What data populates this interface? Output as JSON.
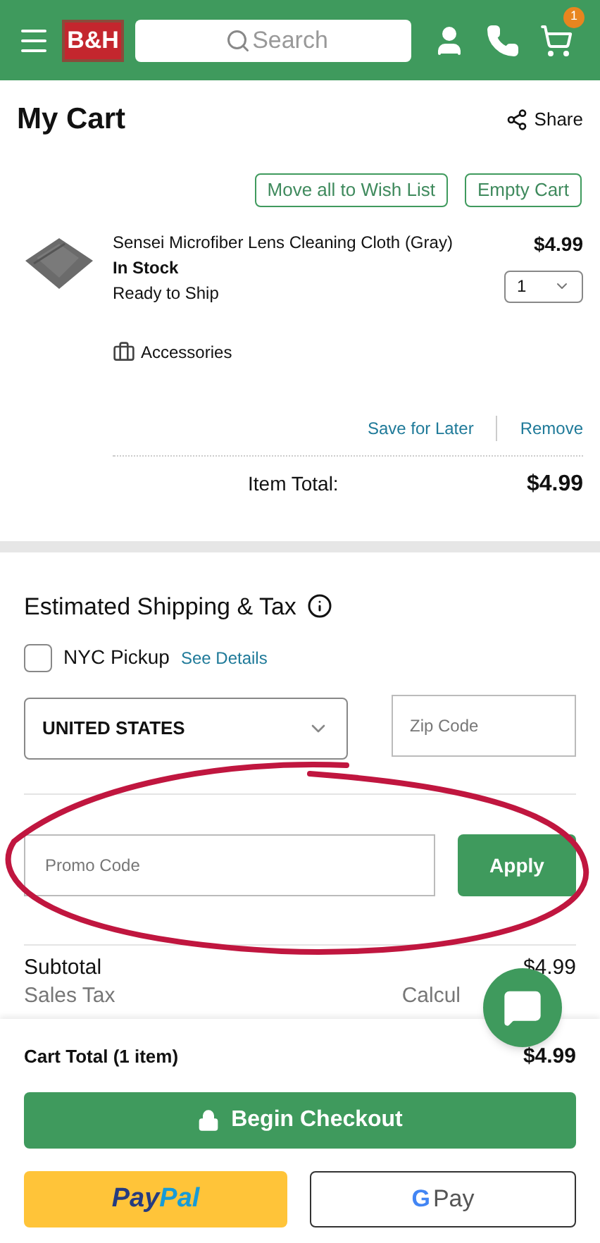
{
  "header": {
    "logo": "B&H",
    "search": {
      "placeholder": "Search"
    },
    "cart_count": "1"
  },
  "cart": {
    "title": "My Cart",
    "share": "Share",
    "move_all": "Move all to Wish List",
    "empty_cart": "Empty Cart",
    "items": [
      {
        "name": "Sensei Microfiber Lens Cleaning Cloth (Gray)",
        "stock": "In Stock",
        "shipping": "Ready to Ship",
        "price": "$4.99",
        "quantity": "1",
        "category": "Accessories",
        "save_for_later": "Save for Later",
        "remove": "Remove",
        "total_label": "Item Total:",
        "total": "$4.99"
      }
    ]
  },
  "shipping": {
    "title": "Estimated Shipping & Tax",
    "nyc_pickup": {
      "label": "NYC Pickup",
      "checked": false
    },
    "see_details": "See Details",
    "country": "UNITED STATES",
    "zip": {
      "placeholder": "Zip Code"
    },
    "promo": {
      "placeholder": "Promo Code"
    },
    "apply": "Apply"
  },
  "summary": [
    {
      "label": "Subtotal",
      "value": "$4.99"
    },
    {
      "label": "Sales Tax",
      "value": "Calcul"
    }
  ],
  "footer": {
    "cart_total_label": "Cart Total (1 item)",
    "cart_total": "$4.99",
    "checkout": "Begin Checkout",
    "paypal": [
      "Pay",
      "Pal"
    ],
    "gpay": [
      "G",
      "Pay"
    ]
  }
}
